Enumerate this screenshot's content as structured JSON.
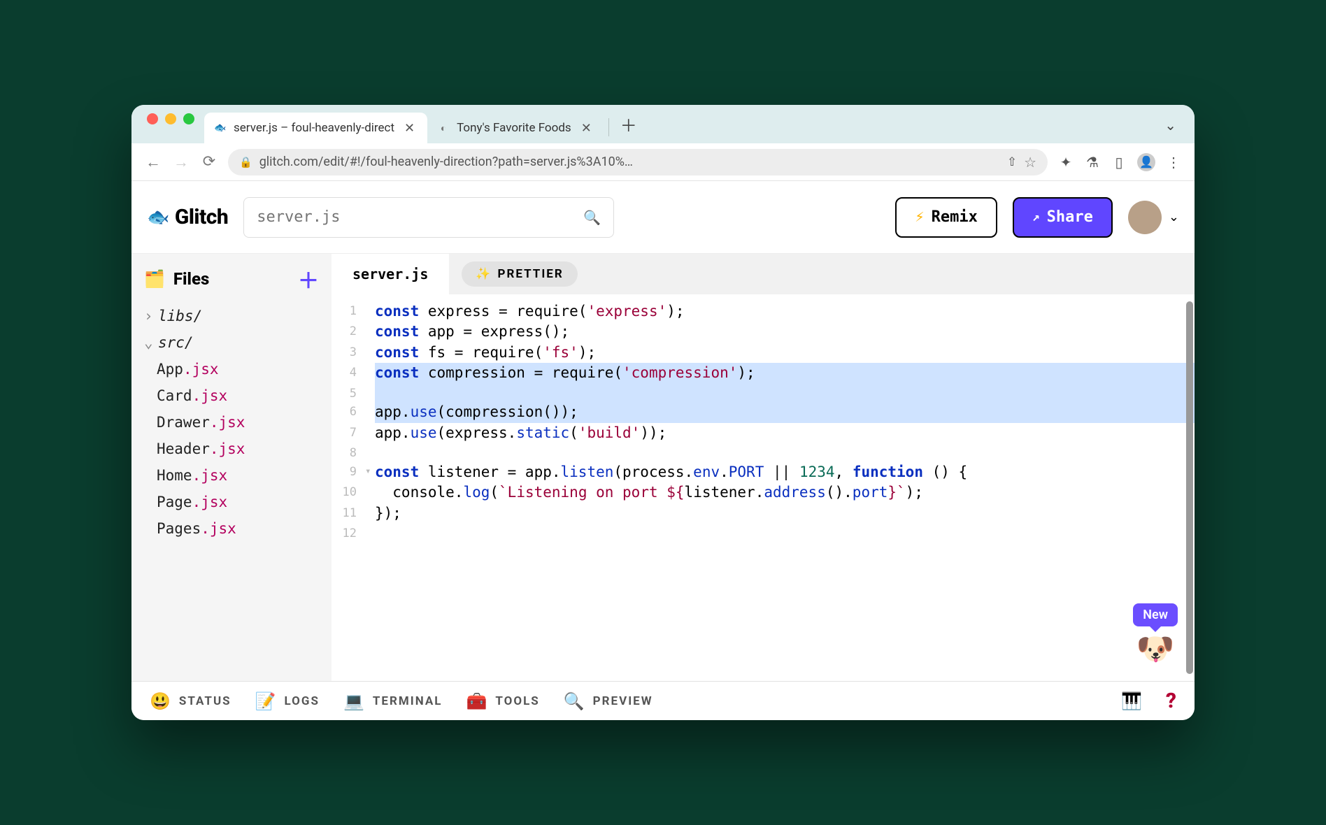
{
  "browser": {
    "tabs": [
      {
        "title": "server.js – foul-heavenly-direct",
        "active": true,
        "favicon": "🐟"
      },
      {
        "title": "Tony's Favorite Foods",
        "active": false,
        "favicon": "◐"
      }
    ],
    "url": "glitch.com/edit/#!/foul-heavenly-direction?path=server.js%3A10%…"
  },
  "glitch": {
    "brand": "Glitch",
    "search_placeholder": "server.js",
    "remix_label": "Remix",
    "share_label": "Share"
  },
  "sidebar": {
    "header": "Files",
    "folders": [
      {
        "name": "libs/",
        "expanded": false
      },
      {
        "name": "src/",
        "expanded": true
      }
    ],
    "files": [
      {
        "base": "App",
        "ext": ".jsx"
      },
      {
        "base": "Card",
        "ext": ".jsx"
      },
      {
        "base": "Drawer",
        "ext": ".jsx"
      },
      {
        "base": "Header",
        "ext": ".jsx"
      },
      {
        "base": "Home",
        "ext": ".jsx"
      },
      {
        "base": "Page",
        "ext": ".jsx"
      },
      {
        "base": "Pages",
        "ext": ".jsx"
      }
    ]
  },
  "editor": {
    "filename": "server.js",
    "prettier_label": "PRETTIER",
    "new_badge": "New",
    "lines": [
      {
        "n": 1,
        "hl": false,
        "fold": "",
        "html": "<span class='kw'>const</span> express = require(<span class='str'>'express'</span>);"
      },
      {
        "n": 2,
        "hl": false,
        "fold": "",
        "html": "<span class='kw'>const</span> app = express();"
      },
      {
        "n": 3,
        "hl": false,
        "fold": "",
        "html": "<span class='kw'>const</span> fs = require(<span class='str'>'fs'</span>);"
      },
      {
        "n": 4,
        "hl": true,
        "fold": "",
        "html": "<span class='kw'>const</span> compression = require(<span class='str'>'compression'</span>);"
      },
      {
        "n": 5,
        "hl": true,
        "fold": "",
        "html": ""
      },
      {
        "n": 6,
        "hl": true,
        "fold": "",
        "html": "app.<span class='prop'>use</span>(compression());"
      },
      {
        "n": 7,
        "hl": false,
        "fold": "",
        "html": "app.<span class='prop'>use</span>(express.<span class='prop'>static</span>(<span class='str'>'build'</span>));"
      },
      {
        "n": 8,
        "hl": false,
        "fold": "",
        "html": ""
      },
      {
        "n": 9,
        "hl": false,
        "fold": "▾",
        "html": "<span class='kw'>const</span> listener = app.<span class='prop'>listen</span>(process.<span class='prop'>env</span>.<span class='prop'>PORT</span> <span class='op'>||</span> <span class='num'>1234</span>, <span class='kw'>function</span> () {"
      },
      {
        "n": 10,
        "hl": false,
        "fold": "",
        "html": "  console.<span class='prop'>log</span>(<span class='str'>`Listening on port ${</span>listener.<span class='prop'>address</span>().<span class='prop'>port</span><span class='str'>}`</span>);"
      },
      {
        "n": 11,
        "hl": false,
        "fold": "",
        "html": "});"
      },
      {
        "n": 12,
        "hl": false,
        "fold": "",
        "html": ""
      }
    ]
  },
  "footer": {
    "items": [
      {
        "emoji": "😃",
        "label": "STATUS"
      },
      {
        "emoji": "📝",
        "label": "LOGS"
      },
      {
        "emoji": "💻",
        "label": "TERMINAL"
      },
      {
        "emoji": "🧰",
        "label": "TOOLS"
      },
      {
        "emoji": "🔍",
        "label": "PREVIEW"
      }
    ]
  }
}
